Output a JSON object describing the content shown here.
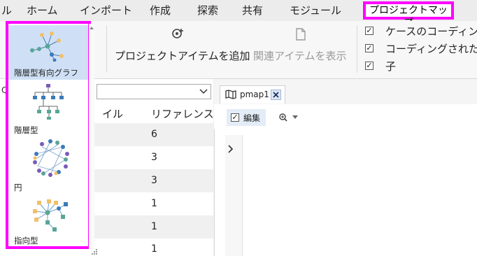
{
  "menubar": {
    "items": [
      "ル",
      "ホーム",
      "インポート",
      "作成",
      "探索",
      "共有",
      "モジュール"
    ],
    "active": "プロジェクトマップ"
  },
  "ribbon": {
    "add_project_items": "プロジェクトアイテムを追加",
    "show_related_items": "関連アイテムを表示",
    "checkboxes": [
      {
        "label": "ケースのコーディング",
        "checked": true
      },
      {
        "label": "コーディングされたフ",
        "checked": true
      },
      {
        "label": "子",
        "checked": true
      }
    ]
  },
  "layout_dropdown": {
    "items": [
      {
        "label": "階層型有向グラフ",
        "selected": true
      },
      {
        "label": "階層型",
        "selected": false
      },
      {
        "label": "円",
        "selected": false
      },
      {
        "label": "指向型",
        "selected": false
      }
    ]
  },
  "list": {
    "search_glyph": "Q",
    "columns": [
      "イル",
      "リファレンス"
    ],
    "references": [
      "6",
      "3",
      "3",
      "1",
      "1",
      "1"
    ]
  },
  "document": {
    "tab_title": "pmap1",
    "edit_label": "編集",
    "edit_checked": true
  },
  "colors": {
    "highlight": "#ff00ff",
    "selection": "#cfe0f6",
    "node_blue": "#3c7ab8",
    "node_orange": "#f2c06a",
    "node_teal": "#5aa596",
    "node_purple": "#7a5bb8"
  }
}
